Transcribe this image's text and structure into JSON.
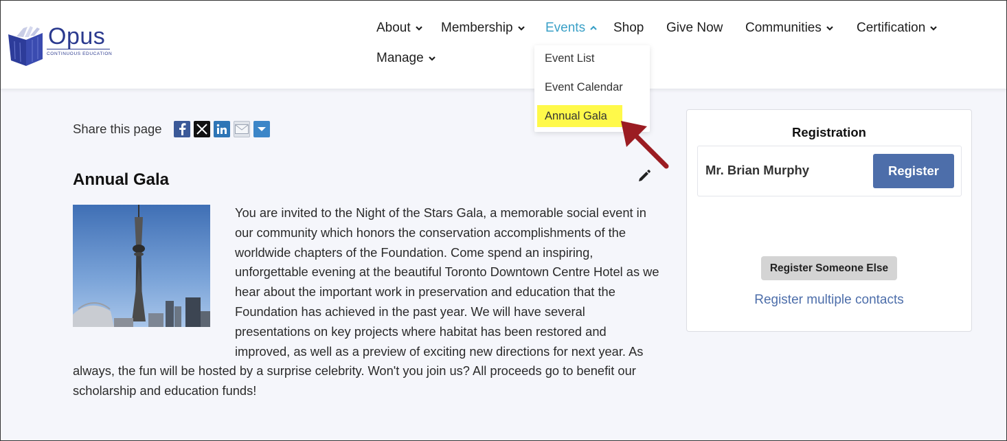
{
  "brand": {
    "name": "Opus",
    "tagline": "CONTINUOUS EDUCATION",
    "color": "#2b3a8f"
  },
  "nav": {
    "items": [
      {
        "label": "About"
      },
      {
        "label": "Membership"
      },
      {
        "label": "Events",
        "active": true
      },
      {
        "label": "Shop"
      },
      {
        "label": "Give Now"
      },
      {
        "label": "Communities"
      },
      {
        "label": "Certification"
      },
      {
        "label": "Manage"
      }
    ],
    "active_color": "#3aa0c7"
  },
  "events_menu": {
    "items": [
      {
        "label": "Event List"
      },
      {
        "label": "Event Calendar"
      },
      {
        "label": "Annual Gala",
        "highlighted": true
      }
    ],
    "highlight_color": "#fff94a"
  },
  "share": {
    "label": "Share this page",
    "icons": [
      "facebook-icon",
      "x-icon",
      "linkedin-icon",
      "email-icon",
      "more-share-icon"
    ]
  },
  "article": {
    "title": "Annual Gala",
    "body": "You are invited to the Night of the Stars Gala, a memorable social event in our community which honors the conservation accomplishments of the worldwide chapters of the Foundation. Come spend an inspiring, unforgettable evening at the beautiful Toronto Downtown Centre Hotel as we hear about the important work in preservation and education that the Foundation has achieved in the past year. We will have several presentations on key projects where habitat has been restored and improved, as well as a preview of exciting new directions for next year. As always, the fun will be hosted by a surprise celebrity. Won't you join us? All proceeds go to benefit our scholarship and education funds!"
  },
  "registration": {
    "title": "Registration",
    "contact_name": "Mr. Brian Murphy",
    "register_label": "Register",
    "register_else_label": "Register Someone Else",
    "register_multiple_label": "Register multiple contacts",
    "button_color": "#4d6eaa"
  },
  "annotation": {
    "arrow_color": "#9b1c22"
  }
}
